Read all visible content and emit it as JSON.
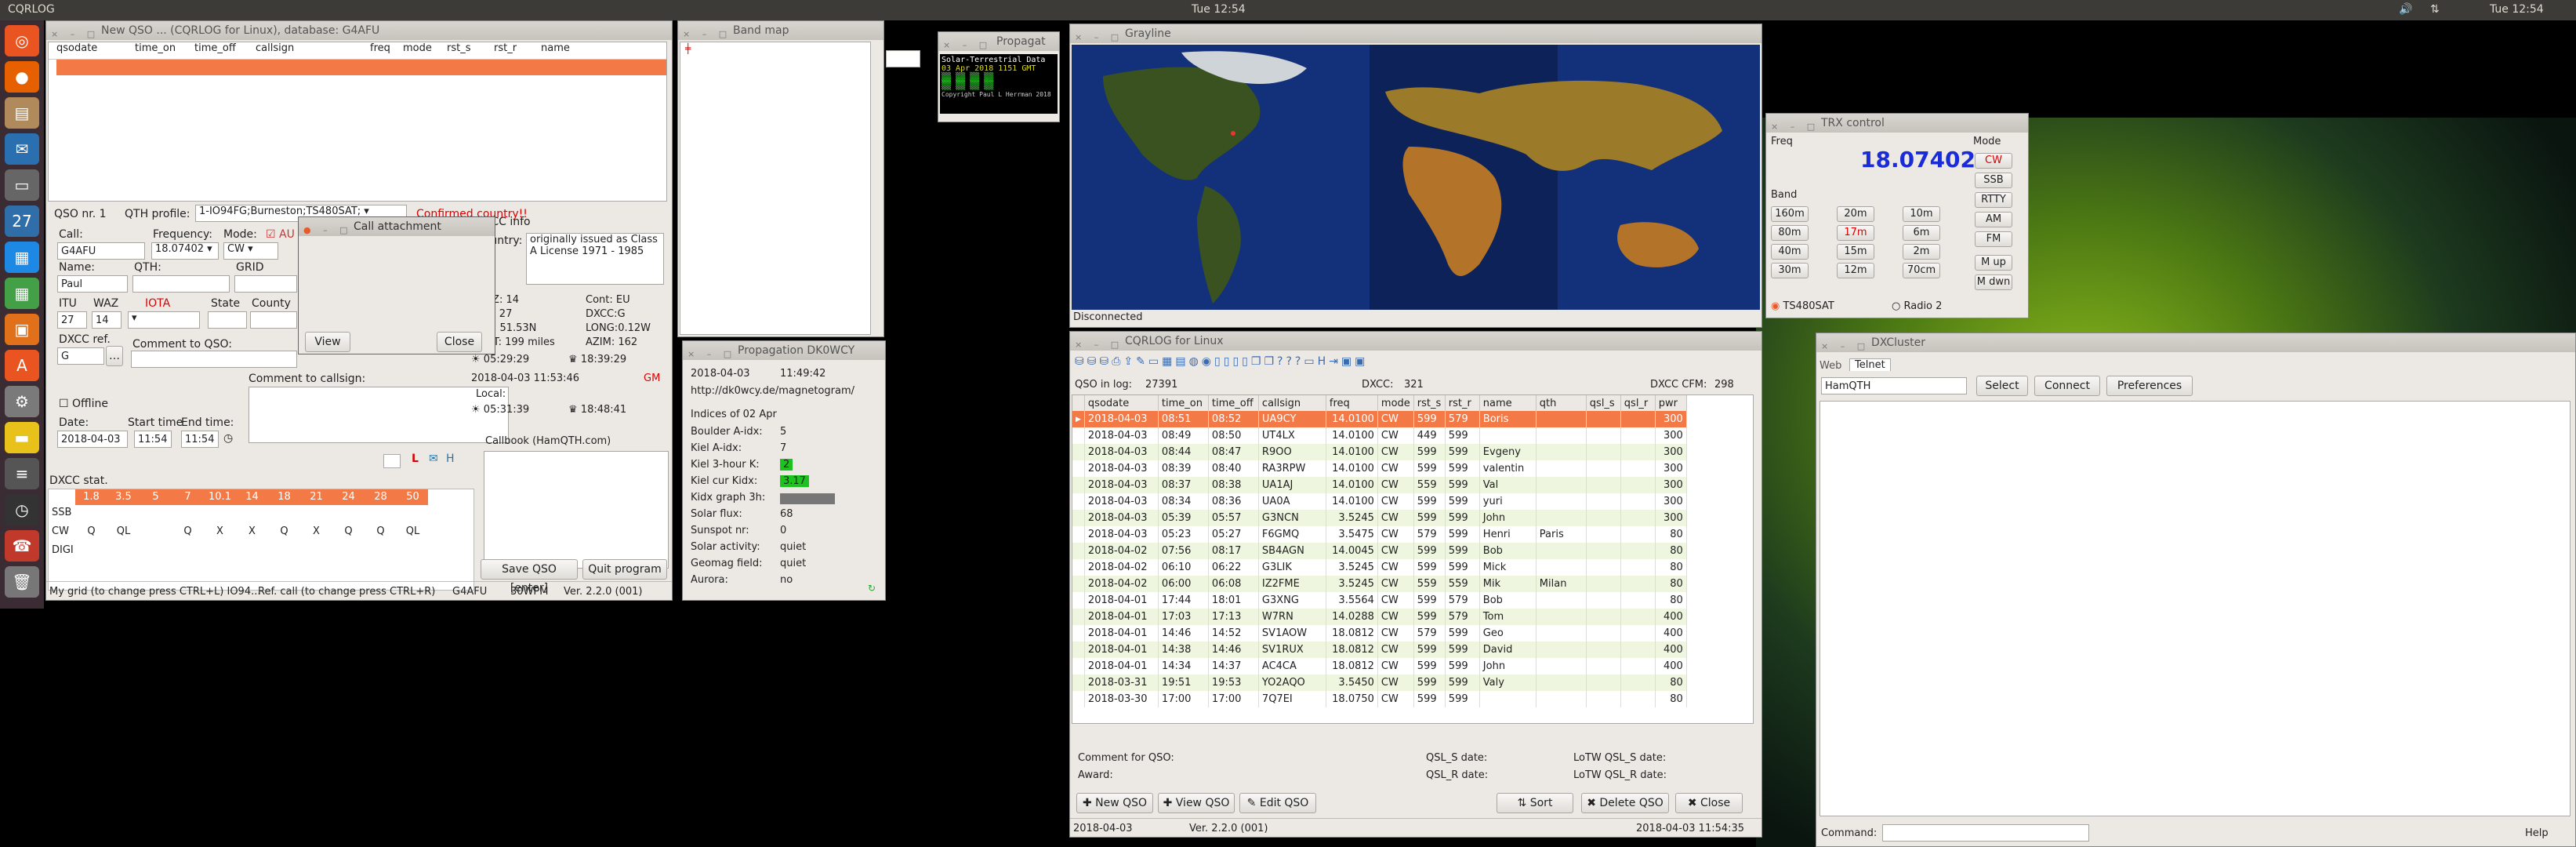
{
  "topbar": {
    "app": "CQRLOG",
    "clock": "Tue 12:54"
  },
  "newqso": {
    "title": "New QSO ... (CQRLOG for Linux), database: G4AFU",
    "columns": [
      "qsodate",
      "time_on",
      "time_off",
      "callsign",
      "freq",
      "mode",
      "rst_s",
      "rst_r",
      "name"
    ],
    "qso_nr": "QSO nr. 1",
    "qth_profile_label": "QTH profile:",
    "qth_profile": "1-IO94FG;Burneston;TS480SAT;",
    "confirmed": "Confirmed country!!",
    "call_label": "Call:",
    "call": "G4AFU",
    "freq_label": "Frequency:",
    "freq": "18.07402",
    "mode_label": "Mode:",
    "mode": "CW",
    "auto": "AU",
    "name_label": "Name:",
    "name": "Paul",
    "qth_label": "QTH:",
    "grid_label": "GRID",
    "itu_label": "ITU",
    "itu": "27",
    "waz_label": "WAZ",
    "waz": "14",
    "iota_label": "IOTA",
    "state_label": "State",
    "county_label": "County",
    "dxcc_ref_label": "DXCC ref.",
    "dxcc_ref": "G",
    "comment_qso_label": "Comment to QSO:",
    "comment_call_label": "Comment to callsign:",
    "offline_label": "Offline",
    "date_label": "Date:",
    "date": "2018-04-03",
    "start_label": "Start time",
    "start": "11:54",
    "end_label": "End time:",
    "end": "11:54",
    "dxcc_stat_label": "DXCC stat.",
    "bands": [
      "1.8",
      "3.5",
      "5",
      "7",
      "10.1",
      "14",
      "18",
      "21",
      "24",
      "28",
      "50"
    ],
    "stat_rows": [
      {
        "mode": "SSB",
        "cells": [
          "",
          "",
          "",
          "",
          "",
          "",
          "",
          "",
          "",
          "",
          ""
        ]
      },
      {
        "mode": "CW",
        "cells": [
          "Q",
          "QL",
          "",
          "Q",
          "X",
          "X",
          "Q",
          "X",
          "Q",
          "Q",
          "QL"
        ]
      },
      {
        "mode": "DIGI",
        "cells": [
          "",
          "",
          "",
          "",
          "",
          "",
          "",
          "",
          "",
          "",
          ""
        ]
      }
    ],
    "dxcc_info_label": "DXCC info",
    "country_label": "Country:",
    "country": "originally issued as Class A License 1971 - 1985",
    "waz_info": "WAZ: 14",
    "itu_info": "ITU: 27",
    "lat": "LAT: 51.53N",
    "dist": "DIST: 199 miles",
    "cont": "Cont: EU",
    "dxcc_info": "DXCC:G",
    "long": "LONG:0.12W",
    "azim": "AZIM: 162",
    "sun1": "05:29:29",
    "sun2": "18:39:29",
    "utc": "2018-04-03 11:53:46",
    "gm": "GM",
    "local_label": "Local:",
    "sun3": "05:31:39",
    "sun4": "18:48:41",
    "callbook_label": "Callbook (HamQTH.com)",
    "save_btn": "Save QSO [enter]",
    "quit_btn": "Quit program",
    "status_left": "My grid (to change press CTRL+L) IO94...",
    "status_mid": "Ref. call (to change press CTRL+R)",
    "status_call": "G4AFU",
    "status_wpm": "30WPM",
    "status_ver": "Ver. 2.2.0 (001)",
    "flag_l": "L"
  },
  "call_attach": {
    "title": "Call attachment",
    "view": "View",
    "close": "Close"
  },
  "bandmap": {
    "title": "Band map"
  },
  "propagation_small": {
    "title": "Propagat",
    "banner1": "Solar-Terrestrial Data",
    "banner2": "03 Apr 2018 1151 GMT",
    "copy": "Copyright Paul L Herrman 2018"
  },
  "prop": {
    "title": "Propagation DK0WCY",
    "date": "2018-04-03",
    "time": "11:49:42",
    "url": "http://dk0wcy.de/magnetogram/",
    "indices": "Indices of 02 Apr",
    "rows": [
      {
        "k": "Boulder A-idx:",
        "v": "5"
      },
      {
        "k": "Kiel A-idx:",
        "v": "7"
      },
      {
        "k": "Kiel 3-hour K:",
        "v": "2"
      },
      {
        "k": "Kiel cur Kidx:",
        "v": "3.17"
      },
      {
        "k": "Kidx graph 3h:",
        "v": ""
      },
      {
        "k": "Solar flux:",
        "v": "68"
      },
      {
        "k": "Sunspot nr:",
        "v": "0"
      },
      {
        "k": "Solar activity:",
        "v": "quiet"
      },
      {
        "k": "Geomag field:",
        "v": "quiet"
      },
      {
        "k": "Aurora:",
        "v": "no"
      }
    ]
  },
  "grayline": {
    "title": "Grayline",
    "status": "Disconnected"
  },
  "trx": {
    "title": "TRX control",
    "freq_label": "Freq",
    "freq": "18.07402",
    "mode_label": "Mode",
    "band_label": "Band",
    "bands": [
      "160m",
      "20m",
      "10m",
      "80m",
      "17m",
      "6m",
      "40m",
      "15m",
      "2m",
      "30m",
      "12m",
      "70cm"
    ],
    "modes": [
      "CW",
      "SSB",
      "RTTY",
      "AM",
      "FM"
    ],
    "mup": "M up",
    "mdwn": "M dwn",
    "radio1": "TS480SAT",
    "radio2": "Radio 2"
  },
  "log": {
    "title": "CQRLOG for Linux",
    "qso_in_log_label": "QSO in log:",
    "qso_in_log": "27391",
    "dxcc_label": "DXCC:",
    "dxcc": "321",
    "cfm_label": "DXCC CFM:",
    "cfm": "298",
    "columns": [
      "qsodate",
      "time_on",
      "time_off",
      "callsign",
      "freq",
      "mode",
      "rst_s",
      "rst_r",
      "name",
      "qth",
      "qsl_s",
      "qsl_r",
      "pwr"
    ],
    "rows": [
      [
        "2018-04-03",
        "08:51",
        "08:52",
        "UA9CY",
        "14.0100",
        "CW",
        "599",
        "579",
        "Boris",
        "",
        "",
        "",
        "300"
      ],
      [
        "2018-04-03",
        "08:49",
        "08:50",
        "UT4LX",
        "14.0100",
        "CW",
        "449",
        "599",
        "",
        "",
        "",
        "",
        "300"
      ],
      [
        "2018-04-03",
        "08:44",
        "08:47",
        "R9OO",
        "14.0100",
        "CW",
        "599",
        "599",
        "Evgeny",
        "",
        "",
        "",
        "300"
      ],
      [
        "2018-04-03",
        "08:39",
        "08:40",
        "RA3RPW",
        "14.0100",
        "CW",
        "599",
        "599",
        "valentin",
        "",
        "",
        "",
        "300"
      ],
      [
        "2018-04-03",
        "08:37",
        "08:38",
        "UA1AJ",
        "14.0100",
        "CW",
        "559",
        "599",
        "Val",
        "",
        "",
        "",
        "300"
      ],
      [
        "2018-04-03",
        "08:34",
        "08:36",
        "UA0A",
        "14.0100",
        "CW",
        "599",
        "599",
        "yuri",
        "",
        "",
        "",
        "300"
      ],
      [
        "2018-04-03",
        "05:39",
        "05:57",
        "G3NCN",
        "3.5245",
        "CW",
        "599",
        "599",
        "John",
        "",
        "",
        "",
        "300"
      ],
      [
        "2018-04-03",
        "05:23",
        "05:27",
        "F6GMQ",
        "3.5475",
        "CW",
        "579",
        "599",
        "Henri",
        "Paris",
        "",
        "",
        "80"
      ],
      [
        "2018-04-02",
        "07:56",
        "08:17",
        "SB4AGN",
        "14.0045",
        "CW",
        "599",
        "599",
        "Bob",
        "",
        "",
        "",
        "80"
      ],
      [
        "2018-04-02",
        "06:10",
        "06:22",
        "G3LIK",
        "3.5245",
        "CW",
        "599",
        "599",
        "Mick",
        "",
        "",
        "",
        "80"
      ],
      [
        "2018-04-02",
        "06:00",
        "06:08",
        "IZ2FME",
        "3.5245",
        "CW",
        "559",
        "559",
        "Mik",
        "Milan",
        "",
        "",
        "80"
      ],
      [
        "2018-04-01",
        "17:44",
        "18:01",
        "G3XNG",
        "3.5564",
        "CW",
        "599",
        "579",
        "Bob",
        "",
        "",
        "",
        "80"
      ],
      [
        "2018-04-01",
        "17:03",
        "17:13",
        "W7RN",
        "14.0288",
        "CW",
        "599",
        "579",
        "Tom",
        "",
        "",
        "",
        "400"
      ],
      [
        "2018-04-01",
        "14:46",
        "14:52",
        "SV1AOW",
        "18.0812",
        "CW",
        "579",
        "599",
        "Geo",
        "",
        "",
        "",
        "400"
      ],
      [
        "2018-04-01",
        "14:38",
        "14:46",
        "SV1RUX",
        "18.0812",
        "CW",
        "599",
        "599",
        "David",
        "",
        "",
        "",
        "400"
      ],
      [
        "2018-04-01",
        "14:34",
        "14:37",
        "AC4CA",
        "18.0812",
        "CW",
        "599",
        "599",
        "John",
        "",
        "",
        "",
        "400"
      ],
      [
        "2018-03-31",
        "19:51",
        "19:53",
        "YO2AQO",
        "3.5450",
        "CW",
        "599",
        "599",
        "Valy",
        "",
        "",
        "",
        "80"
      ],
      [
        "2018-03-30",
        "17:00",
        "17:00",
        "7Q7EI",
        "18.0750",
        "CW",
        "599",
        "599",
        "",
        "",
        "",
        "",
        "80"
      ]
    ],
    "comment_label": "Comment for QSO:",
    "award_label": "Award:",
    "qsls_label": "QSL_S date:",
    "qslr_label": "QSL_R date:",
    "lotws_label": "LoTW QSL_S date:",
    "lotwr_label": "LoTW QSL_R date:",
    "new_btn": "New QSO",
    "view_btn": "View QSO",
    "edit_btn": "Edit QSO",
    "sort_btn": "Sort",
    "delete_btn": "Delete QSO",
    "close_btn": "Close",
    "status_date": "2018-04-03",
    "status_ver": "Ver. 2.2.0 (001)",
    "status_time": "2018-04-03 11:54:35"
  },
  "dxc": {
    "title": "DXCluster",
    "tab_web": "Web",
    "tab_telnet": "Telnet",
    "server": "HamQTH",
    "select": "Select",
    "connect": "Connect",
    "prefs": "Preferences",
    "command_label": "Command:",
    "help": "Help"
  }
}
